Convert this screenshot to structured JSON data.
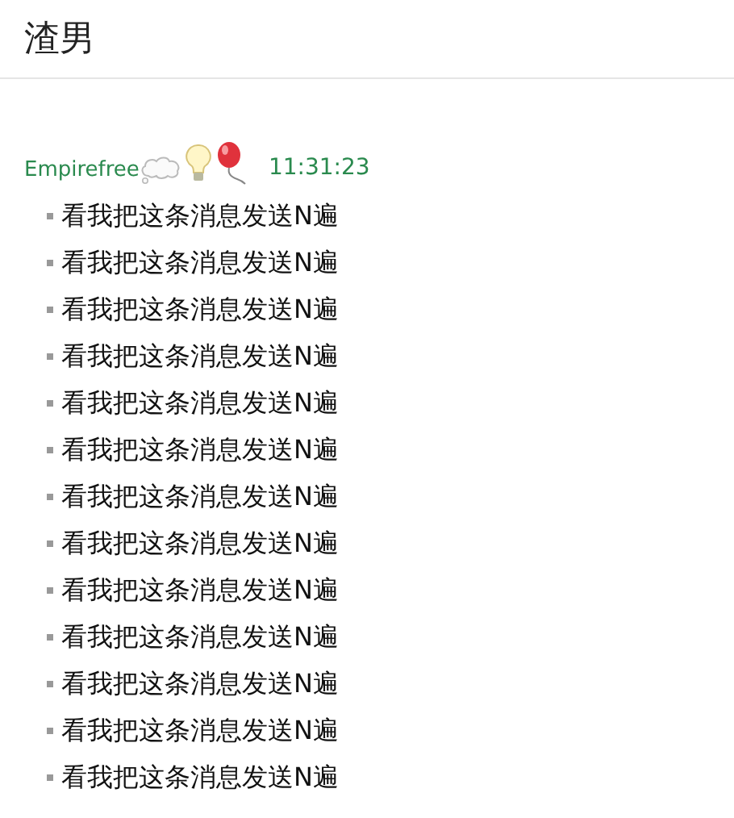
{
  "header": {
    "title": "渣男"
  },
  "message_group": {
    "sender": "Empirefree",
    "time": "11:31:23",
    "messages": [
      "看我把这条消息发送N遍",
      "看我把这条消息发送N遍",
      "看我把这条消息发送N遍",
      "看我把这条消息发送N遍",
      "看我把这条消息发送N遍",
      "看我把这条消息发送N遍",
      "看我把这条消息发送N遍",
      "看我把这条消息发送N遍",
      "看我把这条消息发送N遍",
      "看我把这条消息发送N遍",
      "看我把这条消息发送N遍",
      "看我把这条消息发送N遍",
      "看我把这条消息发送N遍"
    ]
  }
}
